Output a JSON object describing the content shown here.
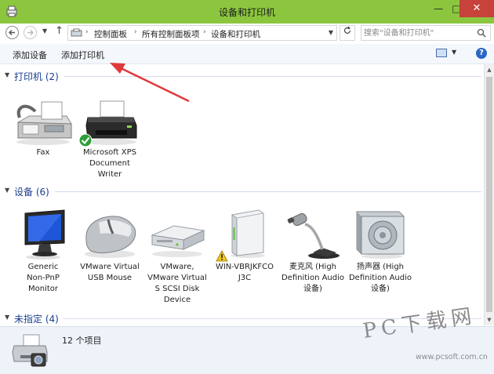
{
  "window": {
    "title": "设备和打印机",
    "minimize": "—",
    "maximize": "□",
    "close": "✕"
  },
  "address": {
    "breadcrumbs": [
      "控制面板",
      "所有控制面板项",
      "设备和打印机"
    ],
    "separator": "›"
  },
  "search": {
    "placeholder": "搜索\"设备和打印机\""
  },
  "toolbar": {
    "add_device": "添加设备",
    "add_printer": "添加打印机",
    "help": "?"
  },
  "groups": {
    "printers": {
      "title": "打印机 (2)",
      "items": [
        {
          "label": "Fax",
          "icon": "fax-icon"
        },
        {
          "label": "Microsoft XPS\nDocument\nWriter",
          "icon": "printer-icon",
          "badge": "default-check-badge"
        }
      ]
    },
    "devices": {
      "title": "设备 (6)",
      "items": [
        {
          "label": "Generic\nNon-PnP\nMonitor",
          "icon": "monitor-icon"
        },
        {
          "label": "VMware Virtual\nUSB Mouse",
          "icon": "mouse-icon"
        },
        {
          "label": "VMware,\nVMware Virtual\nS SCSI Disk\nDevice",
          "icon": "disk-drive-icon"
        },
        {
          "label": "WIN-VBRJKFCO\nJ3C",
          "icon": "computer-tower-icon",
          "badge": "warning-badge"
        },
        {
          "label": "麦克风 (High\nDefinition Audio\n设备)",
          "icon": "microphone-icon"
        },
        {
          "label": "扬声器 (High\nDefinition Audio\n设备)",
          "icon": "speaker-icon"
        }
      ]
    },
    "unspecified": {
      "title": "未指定 (4)"
    }
  },
  "details": {
    "count": "12 个项目"
  },
  "watermark": {
    "main": "PC下载网",
    "sub": "www.pcsoft.com.cn"
  },
  "colors": {
    "titlebar": "#8cc63f",
    "close": "#c7423a",
    "group_title": "#1a3e8e",
    "annotation_arrow": "#e0393b"
  }
}
